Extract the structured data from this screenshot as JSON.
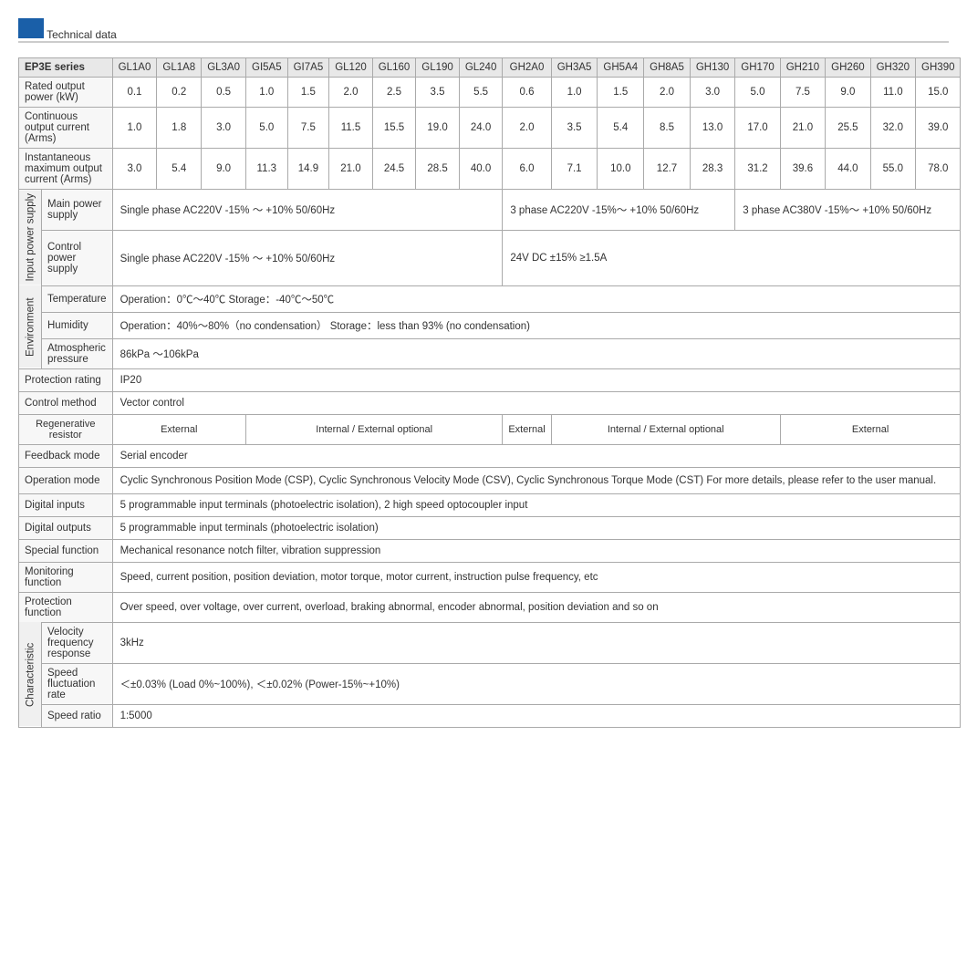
{
  "title": "Technical data",
  "header": {
    "series": "EP3E series",
    "columns": [
      "GL1A0",
      "GL1A8",
      "GL3A0",
      "GI5A5",
      "GI7A5",
      "GL120",
      "GL160",
      "GL190",
      "GL240",
      "GH2A0",
      "GH3A5",
      "GH5A4",
      "GH8A5",
      "GH130",
      "GH170",
      "GH210",
      "GH260",
      "GH320",
      "GH390"
    ]
  },
  "rows": {
    "rated_output_power_label": "Rated output power (kW)",
    "rated_output_power_values": [
      "0.1",
      "0.2",
      "0.5",
      "1.0",
      "1.5",
      "2.0",
      "2.5",
      "3.5",
      "5.5",
      "0.6",
      "1.0",
      "1.5",
      "2.0",
      "3.0",
      "5.0",
      "7.5",
      "9.0",
      "11.0",
      "15.0"
    ],
    "continuous_output_label": "Continuous output current (Arms)",
    "continuous_output_values": [
      "1.0",
      "1.8",
      "3.0",
      "5.0",
      "7.5",
      "11.5",
      "15.5",
      "19.0",
      "24.0",
      "2.0",
      "3.5",
      "5.4",
      "8.5",
      "13.0",
      "17.0",
      "21.0",
      "25.5",
      "32.0",
      "39.0"
    ],
    "instantaneous_label": "Instantaneous maximum output current (Arms)",
    "instantaneous_values": [
      "3.0",
      "5.4",
      "9.0",
      "11.3",
      "14.9",
      "21.0",
      "24.5",
      "28.5",
      "40.0",
      "6.0",
      "7.1",
      "10.0",
      "12.7",
      "28.3",
      "31.2",
      "39.6",
      "44.0",
      "55.0",
      "78.0"
    ]
  },
  "input_power_supply": {
    "section_label": "Input power supply",
    "main_label": "Main power supply",
    "main_col1": "Single phase AC220V -15% ～ +10% 50/60Hz",
    "main_col2": "3 phase AC220V -15%～ +10%  50/60Hz",
    "main_col3": "3 phase AC380V -15%～ +10%  50/60Hz",
    "control_label": "Control power supply",
    "control_col1": "Single phase     AC220V    -15%  ～ +10%   50/60Hz",
    "control_col2": "24V DC     ±15%   ≥1.5A"
  },
  "environment": {
    "section_label": "Environment",
    "temp_label": "Temperature",
    "temp_value": "Operation：0℃～40℃             Storage：-40℃～50℃",
    "humidity_label": "Humidity",
    "humidity_value": "Operation：40%～80%（no condensation）           Storage：less than 93% (no condensation)",
    "atmospheric_label": "Atmospheric pressure",
    "atmospheric_value": "86kPa ～106kPa"
  },
  "protection_rating": {
    "label": "Protection rating",
    "value": "IP20"
  },
  "control_method": {
    "label": "Control method",
    "value": "Vector control"
  },
  "regenerative_resistor": {
    "label": "Regenerative resistor",
    "external1": "External",
    "internal_external1": "Internal / External optional",
    "external2": "External",
    "internal_external2": "Internal / External optional",
    "external3": "External"
  },
  "feedback_mode": {
    "label": "Feedback mode",
    "value": "Serial encoder"
  },
  "operation_mode": {
    "label": "Operation mode",
    "value": "Cyclic Synchronous Position Mode (CSP), Cyclic Synchronous Velocity Mode (CSV), Cyclic Synchronous Torque Mode (CST) For more details, please refer to  the user manual."
  },
  "digital_inputs": {
    "label": "Digital inputs",
    "value": "5 programmable input terminals (photoelectric isolation), 2 high speed optocoupler input"
  },
  "digital_outputs": {
    "label": "Digital outputs",
    "value": "5 programmable input terminals (photoelectric isolation)"
  },
  "special_function": {
    "label": "Special function",
    "value": "Mechanical resonance notch filter, vibration suppression"
  },
  "monitoring_function": {
    "label": "Monitoring function",
    "value": "Speed, current position, position deviation, motor torque, motor current, instruction pulse frequency, etc"
  },
  "protection_function": {
    "label": "Protection function",
    "value": "Over speed, over voltage, over current, overload, braking abnormal, encoder abnormal, position deviation and so on"
  },
  "characteristic": {
    "section_label": "Characteristic",
    "velocity_freq_label": "Velocity frequency response",
    "velocity_freq_value": "3kHz",
    "speed_fluct_label": "Speed fluctuation rate",
    "speed_fluct_value": "＜±0.03% (Load 0%~100%),   ＜±0.02% (Power-15%~+10%)",
    "speed_ratio_label": "Speed ratio",
    "speed_ratio_value": "1:5000"
  }
}
